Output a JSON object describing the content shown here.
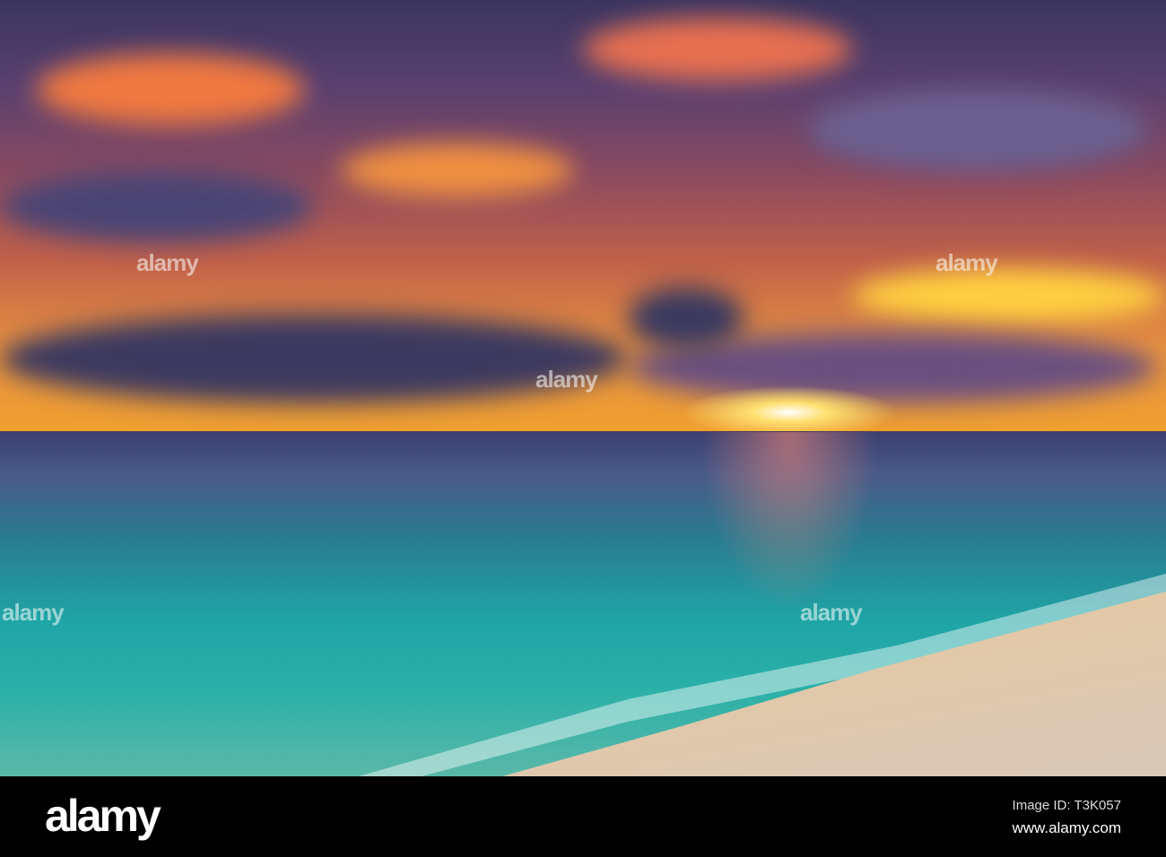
{
  "watermark": {
    "brand": "alamy"
  },
  "footer": {
    "logo": "alamy",
    "image_id": "Image ID: T3K057",
    "url": "www.alamy.com"
  }
}
